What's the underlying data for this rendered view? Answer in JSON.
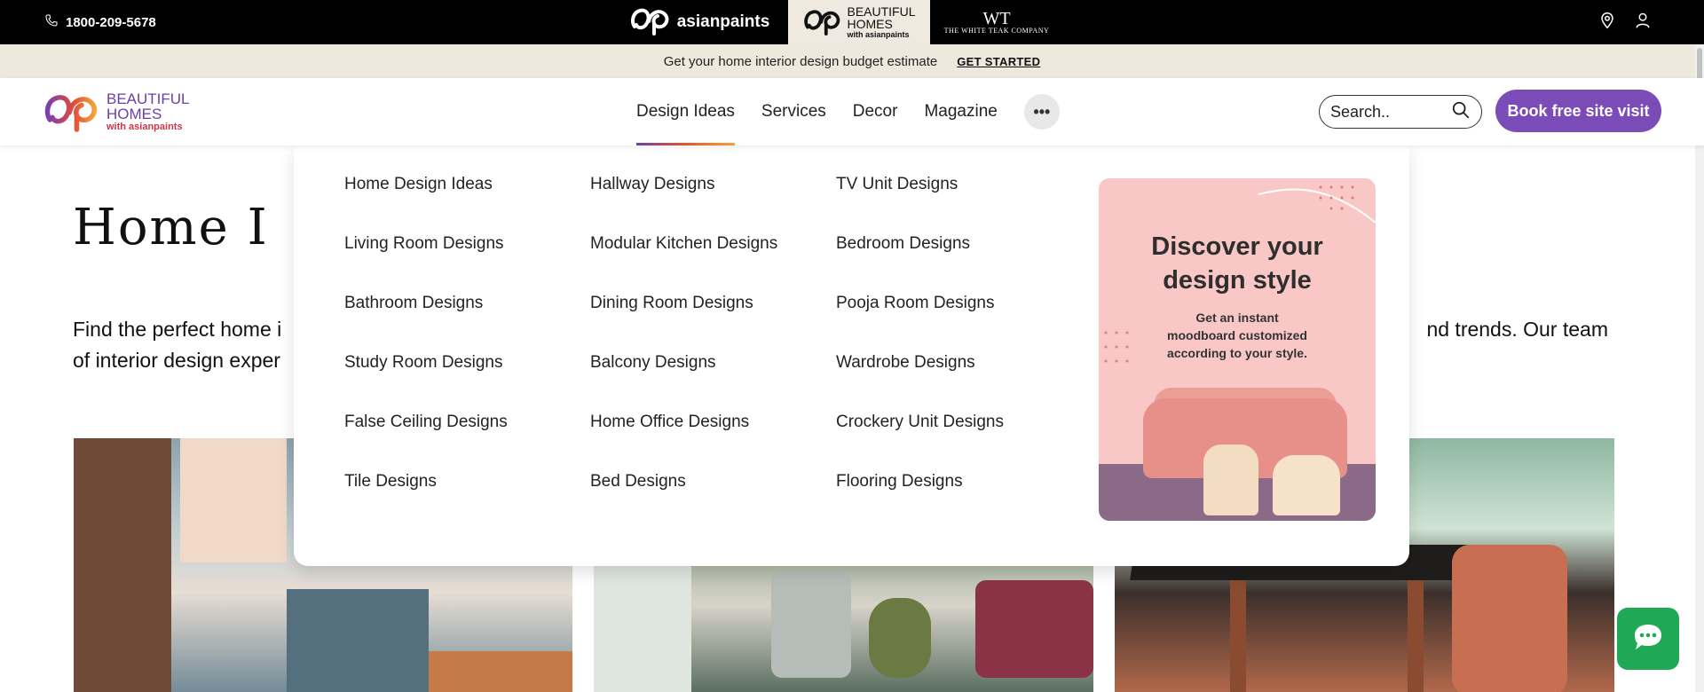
{
  "topbar": {
    "phone": "1800-209-5678",
    "brands": {
      "asianpaints": "asianpaints",
      "beautiful_homes_line1": "BEAUTIFUL",
      "beautiful_homes_line2": "HOMES",
      "beautiful_homes_sub": "with asianpaints",
      "white_teak_mono": "WT",
      "white_teak_name": "THE WHITE TEAK COMPANY"
    },
    "icons": [
      "phone-icon",
      "location-icon",
      "user-icon"
    ]
  },
  "promo_bar": {
    "text": "Get your home interior design budget estimate",
    "cta": "GET STARTED"
  },
  "header": {
    "logo": {
      "line1": "BEAUTIFUL",
      "line2": "HOMES",
      "sub": "with asianpaints"
    },
    "nav": [
      {
        "label": "Design Ideas",
        "active": true
      },
      {
        "label": "Services"
      },
      {
        "label": "Decor"
      },
      {
        "label": "Magazine"
      }
    ],
    "more_label": "•••",
    "search_placeholder": "Search..",
    "book_button": "Book free site visit",
    "accent_color": "#7b4bb7"
  },
  "mega_menu": {
    "columns": [
      [
        "Home Design Ideas",
        "Living Room Designs",
        "Bathroom Designs",
        "Study Room Designs",
        "False Ceiling Designs",
        "Tile Designs"
      ],
      [
        "Hallway Designs",
        "Modular Kitchen Designs",
        "Dining Room Designs",
        "Balcony Designs",
        "Home Office Designs",
        "Bed Designs"
      ],
      [
        "TV Unit Designs",
        "Bedroom Designs",
        "Pooja Room Designs",
        "Wardrobe Designs",
        "Crockery Unit Designs",
        "Flooring Designs"
      ]
    ],
    "promo": {
      "heading_line1": "Discover your",
      "heading_line2": "design style",
      "sub_line1": "Get an instant",
      "sub_line2": "moodboard customized",
      "sub_line3": "according to your style."
    }
  },
  "page": {
    "title": "Home I",
    "desc_line1": "Find the perfect home i",
    "desc_line1_tail": "nd trends. Our team",
    "desc_line2": "of interior design exper"
  },
  "chat_icon": "chat-icon"
}
